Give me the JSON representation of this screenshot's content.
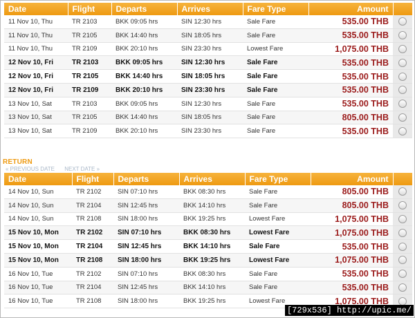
{
  "columns": {
    "date": "Date",
    "flight": "Flight",
    "departs": "Departs",
    "arrives": "Arrives",
    "fare_type": "Fare Type",
    "amount": "Amount"
  },
  "outbound": {
    "rows": [
      {
        "date": "11 Nov 10, Thu",
        "flight": "TR 2103",
        "departs": "BKK 09:05 hrs",
        "arrives": "SIN 12:30 hrs",
        "fare": "Sale Fare",
        "amount": "535.00 THB"
      },
      {
        "date": "11 Nov 10, Thu",
        "flight": "TR 2105",
        "departs": "BKK 14:40 hrs",
        "arrives": "SIN 18:05 hrs",
        "fare": "Sale Fare",
        "amount": "535.00 THB"
      },
      {
        "date": "11 Nov 10, Thu",
        "flight": "TR 2109",
        "departs": "BKK 20:10 hrs",
        "arrives": "SIN 23:30 hrs",
        "fare": "Lowest Fare",
        "amount": "1,075.00 THB"
      },
      {
        "date": "12 Nov 10, Fri",
        "flight": "TR 2103",
        "departs": "BKK 09:05 hrs",
        "arrives": "SIN 12:30 hrs",
        "fare": "Sale Fare",
        "amount": "535.00 THB"
      },
      {
        "date": "12 Nov 10, Fri",
        "flight": "TR 2105",
        "departs": "BKK 14:40 hrs",
        "arrives": "SIN 18:05 hrs",
        "fare": "Sale Fare",
        "amount": "535.00 THB"
      },
      {
        "date": "12 Nov 10, Fri",
        "flight": "TR 2109",
        "departs": "BKK 20:10 hrs",
        "arrives": "SIN 23:30 hrs",
        "fare": "Sale Fare",
        "amount": "535.00 THB"
      },
      {
        "date": "13 Nov 10, Sat",
        "flight": "TR 2103",
        "departs": "BKK 09:05 hrs",
        "arrives": "SIN 12:30 hrs",
        "fare": "Sale Fare",
        "amount": "535.00 THB"
      },
      {
        "date": "13 Nov 10, Sat",
        "flight": "TR 2105",
        "departs": "BKK 14:40 hrs",
        "arrives": "SIN 18:05 hrs",
        "fare": "Sale Fare",
        "amount": "805.00 THB"
      },
      {
        "date": "13 Nov 10, Sat",
        "flight": "TR 2109",
        "departs": "BKK 20:10 hrs",
        "arrives": "SIN 23:30 hrs",
        "fare": "Sale Fare",
        "amount": "535.00 THB"
      }
    ]
  },
  "return": {
    "label": "RETURN",
    "prev_date": "« PREVIOUS DATE",
    "next_date": "NEXT DATE »",
    "rows": [
      {
        "date": "14 Nov 10, Sun",
        "flight": "TR 2102",
        "departs": "SIN 07:10 hrs",
        "arrives": "BKK 08:30 hrs",
        "fare": "Sale Fare",
        "amount": "805.00 THB"
      },
      {
        "date": "14 Nov 10, Sun",
        "flight": "TR 2104",
        "departs": "SIN 12:45 hrs",
        "arrives": "BKK 14:10 hrs",
        "fare": "Sale Fare",
        "amount": "805.00 THB"
      },
      {
        "date": "14 Nov 10, Sun",
        "flight": "TR 2108",
        "departs": "SIN 18:00 hrs",
        "arrives": "BKK 19:25 hrs",
        "fare": "Lowest Fare",
        "amount": "1,075.00 THB"
      },
      {
        "date": "15 Nov 10, Mon",
        "flight": "TR 2102",
        "departs": "SIN 07:10 hrs",
        "arrives": "BKK 08:30 hrs",
        "fare": "Lowest Fare",
        "amount": "1,075.00 THB"
      },
      {
        "date": "15 Nov 10, Mon",
        "flight": "TR 2104",
        "departs": "SIN 12:45 hrs",
        "arrives": "BKK 14:10 hrs",
        "fare": "Sale Fare",
        "amount": "535.00 THB"
      },
      {
        "date": "15 Nov 10, Mon",
        "flight": "TR 2108",
        "departs": "SIN 18:00 hrs",
        "arrives": "BKK 19:25 hrs",
        "fare": "Lowest Fare",
        "amount": "1,075.00 THB"
      },
      {
        "date": "16 Nov 10, Tue",
        "flight": "TR 2102",
        "departs": "SIN 07:10 hrs",
        "arrives": "BKK 08:30 hrs",
        "fare": "Sale Fare",
        "amount": "535.00 THB"
      },
      {
        "date": "16 Nov 10, Tue",
        "flight": "TR 2104",
        "departs": "SIN 12:45 hrs",
        "arrives": "BKK 14:10 hrs",
        "fare": "Sale Fare",
        "amount": "535.00 THB"
      },
      {
        "date": "16 Nov 10, Tue",
        "flight": "TR 2108",
        "departs": "SIN 18:00 hrs",
        "arrives": "BKK 19:25 hrs",
        "fare": "Lowest Fare",
        "amount": "1,075.00 THB"
      }
    ]
  },
  "watermark": "[729x536] http://upic.me/",
  "colors": {
    "header": "#ee9a11",
    "amount": "#9b1b1b",
    "return_label": "#ee9a11"
  }
}
